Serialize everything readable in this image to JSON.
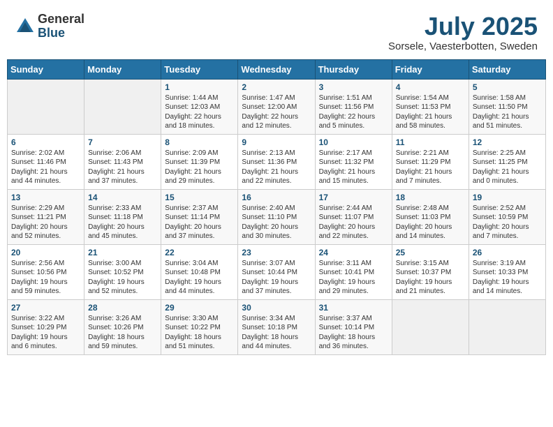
{
  "header": {
    "logo_general": "General",
    "logo_blue": "Blue",
    "month_year": "July 2025",
    "location": "Sorsele, Vaesterbotten, Sweden"
  },
  "weekdays": [
    "Sunday",
    "Monday",
    "Tuesday",
    "Wednesday",
    "Thursday",
    "Friday",
    "Saturday"
  ],
  "weeks": [
    [
      {
        "day": "",
        "details": ""
      },
      {
        "day": "",
        "details": ""
      },
      {
        "day": "1",
        "details": "Sunrise: 1:44 AM\nSunset: 12:03 AM\nDaylight: 22 hours\nand 18 minutes."
      },
      {
        "day": "2",
        "details": "Sunrise: 1:47 AM\nSunset: 12:00 AM\nDaylight: 22 hours\nand 12 minutes."
      },
      {
        "day": "3",
        "details": "Sunrise: 1:51 AM\nSunset: 11:56 PM\nDaylight: 22 hours\nand 5 minutes."
      },
      {
        "day": "4",
        "details": "Sunrise: 1:54 AM\nSunset: 11:53 PM\nDaylight: 21 hours\nand 58 minutes."
      },
      {
        "day": "5",
        "details": "Sunrise: 1:58 AM\nSunset: 11:50 PM\nDaylight: 21 hours\nand 51 minutes."
      }
    ],
    [
      {
        "day": "6",
        "details": "Sunrise: 2:02 AM\nSunset: 11:46 PM\nDaylight: 21 hours\nand 44 minutes."
      },
      {
        "day": "7",
        "details": "Sunrise: 2:06 AM\nSunset: 11:43 PM\nDaylight: 21 hours\nand 37 minutes."
      },
      {
        "day": "8",
        "details": "Sunrise: 2:09 AM\nSunset: 11:39 PM\nDaylight: 21 hours\nand 29 minutes."
      },
      {
        "day": "9",
        "details": "Sunrise: 2:13 AM\nSunset: 11:36 PM\nDaylight: 21 hours\nand 22 minutes."
      },
      {
        "day": "10",
        "details": "Sunrise: 2:17 AM\nSunset: 11:32 PM\nDaylight: 21 hours\nand 15 minutes."
      },
      {
        "day": "11",
        "details": "Sunrise: 2:21 AM\nSunset: 11:29 PM\nDaylight: 21 hours\nand 7 minutes."
      },
      {
        "day": "12",
        "details": "Sunrise: 2:25 AM\nSunset: 11:25 PM\nDaylight: 21 hours\nand 0 minutes."
      }
    ],
    [
      {
        "day": "13",
        "details": "Sunrise: 2:29 AM\nSunset: 11:21 PM\nDaylight: 20 hours\nand 52 minutes."
      },
      {
        "day": "14",
        "details": "Sunrise: 2:33 AM\nSunset: 11:18 PM\nDaylight: 20 hours\nand 45 minutes."
      },
      {
        "day": "15",
        "details": "Sunrise: 2:37 AM\nSunset: 11:14 PM\nDaylight: 20 hours\nand 37 minutes."
      },
      {
        "day": "16",
        "details": "Sunrise: 2:40 AM\nSunset: 11:10 PM\nDaylight: 20 hours\nand 30 minutes."
      },
      {
        "day": "17",
        "details": "Sunrise: 2:44 AM\nSunset: 11:07 PM\nDaylight: 20 hours\nand 22 minutes."
      },
      {
        "day": "18",
        "details": "Sunrise: 2:48 AM\nSunset: 11:03 PM\nDaylight: 20 hours\nand 14 minutes."
      },
      {
        "day": "19",
        "details": "Sunrise: 2:52 AM\nSunset: 10:59 PM\nDaylight: 20 hours\nand 7 minutes."
      }
    ],
    [
      {
        "day": "20",
        "details": "Sunrise: 2:56 AM\nSunset: 10:56 PM\nDaylight: 19 hours\nand 59 minutes."
      },
      {
        "day": "21",
        "details": "Sunrise: 3:00 AM\nSunset: 10:52 PM\nDaylight: 19 hours\nand 52 minutes."
      },
      {
        "day": "22",
        "details": "Sunrise: 3:04 AM\nSunset: 10:48 PM\nDaylight: 19 hours\nand 44 minutes."
      },
      {
        "day": "23",
        "details": "Sunrise: 3:07 AM\nSunset: 10:44 PM\nDaylight: 19 hours\nand 37 minutes."
      },
      {
        "day": "24",
        "details": "Sunrise: 3:11 AM\nSunset: 10:41 PM\nDaylight: 19 hours\nand 29 minutes."
      },
      {
        "day": "25",
        "details": "Sunrise: 3:15 AM\nSunset: 10:37 PM\nDaylight: 19 hours\nand 21 minutes."
      },
      {
        "day": "26",
        "details": "Sunrise: 3:19 AM\nSunset: 10:33 PM\nDaylight: 19 hours\nand 14 minutes."
      }
    ],
    [
      {
        "day": "27",
        "details": "Sunrise: 3:22 AM\nSunset: 10:29 PM\nDaylight: 19 hours\nand 6 minutes."
      },
      {
        "day": "28",
        "details": "Sunrise: 3:26 AM\nSunset: 10:26 PM\nDaylight: 18 hours\nand 59 minutes."
      },
      {
        "day": "29",
        "details": "Sunrise: 3:30 AM\nSunset: 10:22 PM\nDaylight: 18 hours\nand 51 minutes."
      },
      {
        "day": "30",
        "details": "Sunrise: 3:34 AM\nSunset: 10:18 PM\nDaylight: 18 hours\nand 44 minutes."
      },
      {
        "day": "31",
        "details": "Sunrise: 3:37 AM\nSunset: 10:14 PM\nDaylight: 18 hours\nand 36 minutes."
      },
      {
        "day": "",
        "details": ""
      },
      {
        "day": "",
        "details": ""
      }
    ]
  ]
}
